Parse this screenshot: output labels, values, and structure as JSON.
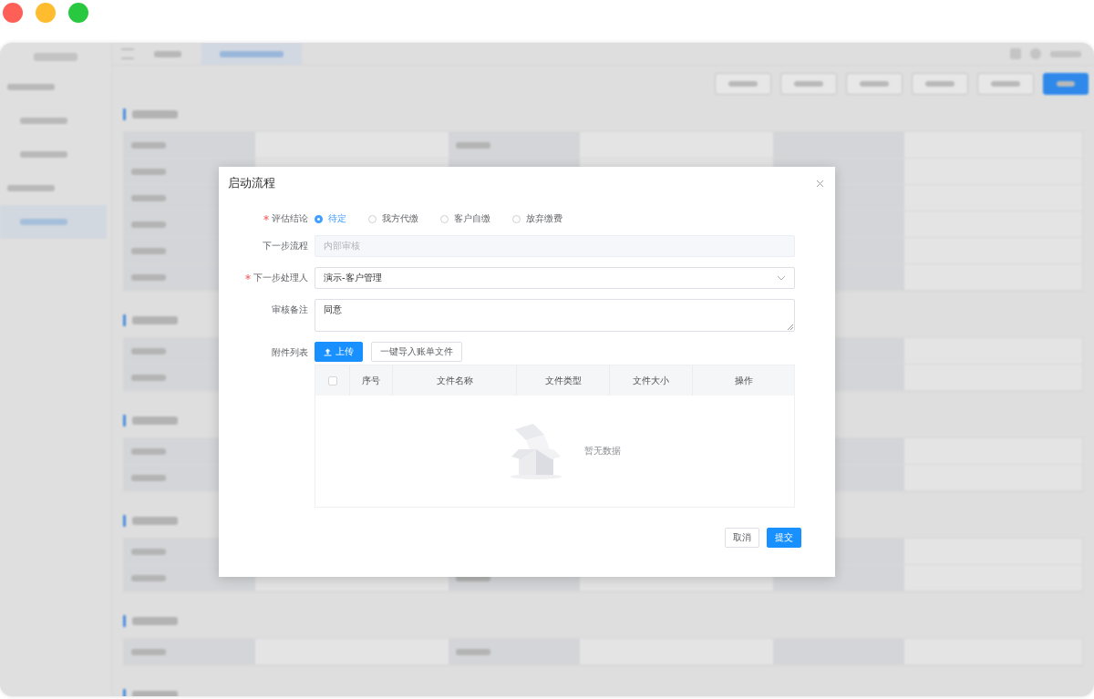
{
  "dialog": {
    "title": "启动流程",
    "fields": [
      {
        "kind": "radio",
        "label": "评估结论",
        "required": true,
        "options": [
          {
            "label": "待定",
            "selected": true
          },
          {
            "label": "我方代缴",
            "selected": false
          },
          {
            "label": "客户自缴",
            "selected": false
          },
          {
            "label": "放弃缴费",
            "selected": false
          }
        ]
      },
      {
        "kind": "input",
        "label": "下一步流程",
        "required": false,
        "value": "内部审核",
        "disabled": true
      },
      {
        "kind": "select",
        "label": "下一步处理人",
        "required": true,
        "value": "演示-客户管理"
      },
      {
        "kind": "textarea",
        "label": "审核备注",
        "required": false,
        "value": "同意"
      },
      {
        "kind": "attachments",
        "label": "附件列表",
        "required": false,
        "buttons": [
          {
            "label": "上传",
            "primary": true
          },
          {
            "label": "一键导入账单文件",
            "primary": false
          }
        ],
        "table": {
          "select_all_checked": false,
          "columns": [
            "序号",
            "文件名称",
            "文件类型",
            "文件大小",
            "操作"
          ],
          "empty_text": "暂无数据"
        }
      }
    ],
    "buttons": [
      {
        "label": "取消",
        "primary": false
      },
      {
        "label": "提交",
        "primary": true
      }
    ]
  }
}
